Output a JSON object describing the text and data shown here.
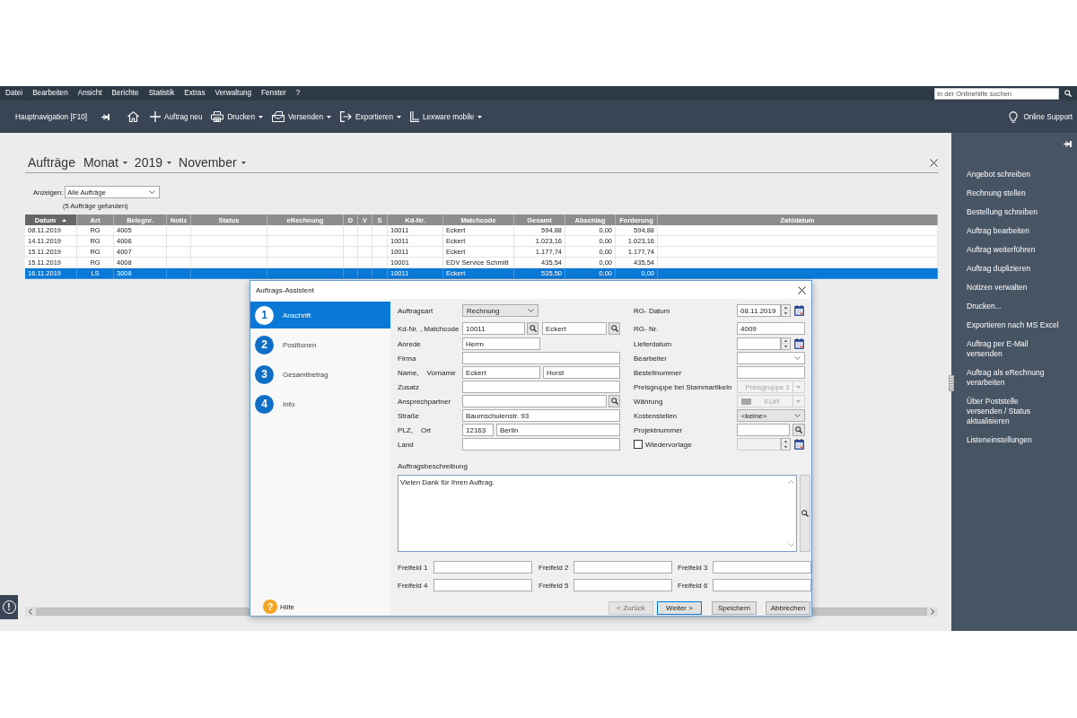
{
  "menu_bar": {
    "items": [
      "Datei",
      "Bearbeiten",
      "Ansicht",
      "Berichte",
      "Statistik",
      "Extras",
      "Verwaltung",
      "Fenster",
      "?"
    ],
    "search": {
      "placeholder": "In der Onlinehilfe suchen"
    }
  },
  "toolbar": {
    "navigation": "Hauptnavigation [F10]",
    "buttons": [
      {
        "label": "Auftrag neu",
        "dropdown": false
      },
      {
        "label": "Drucken",
        "dropdown": true
      },
      {
        "label": "Versenden",
        "dropdown": true
      },
      {
        "label": "Exportieren",
        "dropdown": true
      },
      {
        "label": "Lexware mobile",
        "dropdown": true
      }
    ],
    "support": "Online Support"
  },
  "orders": {
    "title": "Aufträge",
    "periods": [
      "Monat",
      "2019",
      "November"
    ],
    "filter": {
      "label": "Anzeigen:",
      "value": "Alle Aufträge"
    },
    "result_count": "(5 Aufträge gefunden)",
    "table": {
      "columns": [
        {
          "label": "Datum",
          "sorted": true
        },
        {
          "label": "Art",
          "sorted": false
        },
        {
          "label": "Belegnr.",
          "sorted": false
        },
        {
          "label": "Notiz",
          "sorted": false
        },
        {
          "label": "Status",
          "sorted": false
        },
        {
          "label": "eRechnung",
          "sorted": false
        },
        {
          "label": "D",
          "sorted": false
        },
        {
          "label": "V",
          "sorted": false
        },
        {
          "label": "S",
          "sorted": false
        },
        {
          "label": "Kd-Nr.",
          "sorted": false
        },
        {
          "label": "Matchcode",
          "sorted": false
        },
        {
          "label": "Gesamt",
          "sorted": false
        },
        {
          "label": "Abschlag",
          "sorted": false
        },
        {
          "label": "Forderung",
          "sorted": false
        },
        {
          "label": "Zahldatum",
          "sorted": false
        }
      ],
      "rows": [
        {
          "datum": "08.11.2019",
          "art": "RG",
          "belegnr": "4005",
          "kd_nr": "10011",
          "matchcode": "Eckert",
          "gesamt": "594,88",
          "abschlag": "0,00",
          "forderung": "594,88",
          "selected": false
        },
        {
          "datum": "14.11.2019",
          "art": "RG",
          "belegnr": "4006",
          "kd_nr": "10011",
          "matchcode": "Eckert",
          "gesamt": "1.023,16",
          "abschlag": "0,00",
          "forderung": "1.023,16",
          "selected": false
        },
        {
          "datum": "15.11.2019",
          "art": "RG",
          "belegnr": "4007",
          "kd_nr": "10011",
          "matchcode": "Eckert",
          "gesamt": "1.177,74",
          "abschlag": "0,00",
          "forderung": "1.177,74",
          "selected": false
        },
        {
          "datum": "15.11.2019",
          "art": "RG",
          "belegnr": "4008",
          "kd_nr": "10001",
          "matchcode": "EDV Service Schmitt",
          "gesamt": "435,54",
          "abschlag": "0,00",
          "forderung": "435,54",
          "selected": false
        },
        {
          "datum": "16.11.2019",
          "art": "LS",
          "belegnr": "3008",
          "kd_nr": "10011",
          "matchcode": "Eckert",
          "gesamt": "535,50",
          "abschlag": "0,00",
          "forderung": "0,00",
          "selected": true
        }
      ]
    },
    "notice": "!"
  },
  "sidebar": {
    "items": [
      "Angebot schreiben",
      "Rechnung stellen",
      "Bestellung schreiben",
      "Auftrag bearbeiten",
      "Auftrag weiterführen",
      "Auftrag duplizieren",
      "Notizen verwalten",
      "Drucken...",
      "Exportieren nach MS Excel",
      "Auftrag per E-Mail\nversenden",
      "Auftrag als eRechnung\nverarbeiten",
      "Über Poststelle\nversenden / Status\naktualisieren",
      "Listeneinstellungen"
    ]
  },
  "dialog": {
    "title": "Auftrags-Assistent",
    "steps": [
      {
        "number": "1",
        "label": "Anschrift",
        "selected": true
      },
      {
        "number": "2",
        "label": "Positionen",
        "selected": false
      },
      {
        "number": "3",
        "label": "Gesamtbetrag",
        "selected": false
      },
      {
        "number": "4",
        "label": "Info",
        "selected": false
      }
    ],
    "address_fields": [
      {
        "label": "Auftragsart",
        "inputs": [
          {
            "kind": "select",
            "value": "Rechnung"
          }
        ]
      },
      {
        "label": "Kd-Nr. , Matchcode",
        "inputs": [
          {
            "kind": "search",
            "value": "10011"
          },
          {
            "kind": "search",
            "value": "Eckert"
          }
        ]
      },
      {
        "label": "Anrede",
        "inputs": [
          {
            "kind": "text",
            "value": "Herrn"
          }
        ]
      },
      {
        "label": "Firma",
        "inputs": [
          {
            "kind": "text"
          }
        ]
      },
      {
        "label": "Name,",
        "label_2": "Vorname",
        "inputs": [
          {
            "kind": "text",
            "value": "Eckert"
          },
          {
            "kind": "text",
            "value": "Horst"
          }
        ]
      },
      {
        "label": "Zusatz",
        "inputs": [
          {
            "kind": "text"
          }
        ]
      },
      {
        "label": "Ansprechpartner",
        "inputs": [
          {
            "kind": "search"
          }
        ]
      },
      {
        "label": "Straße",
        "inputs": [
          {
            "kind": "text",
            "value": "Baumschulenstr. 93"
          }
        ]
      },
      {
        "label": "PLZ,",
        "label_2": "Ort",
        "inputs": [
          {
            "kind": "text",
            "value": "12163"
          },
          {
            "kind": "text",
            "value": "Berlin"
          }
        ]
      },
      {
        "label": "Land",
        "inputs": [
          {
            "kind": "text"
          }
        ]
      }
    ],
    "order_fields": [
      {
        "label": "RG- Datum",
        "kind": "date",
        "value": "08.11.2019",
        "disabled": false
      },
      {
        "label": "RG- Nr.",
        "kind": "text",
        "value": "4009",
        "disabled": false
      },
      {
        "label": "Lieferdatum",
        "kind": "date",
        "disabled": false
      },
      {
        "label": "Bearbeiter",
        "kind": "combo",
        "disabled": false
      },
      {
        "label": "Bestellnummer",
        "kind": "text",
        "disabled": false
      },
      {
        "label": "Preisgruppe bei Stammartikeln",
        "kind": "picker",
        "value": "Preisgruppe 1",
        "disabled": true
      },
      {
        "label": "Währung",
        "kind": "currency",
        "value": "EUR",
        "disabled": true
      },
      {
        "label": "Kostenstellen",
        "kind": "select",
        "value": "<keine>",
        "disabled": false
      },
      {
        "label": "Projektnummer",
        "kind": "search",
        "disabled": false
      },
      {
        "label": "Wiedervorlage",
        "kind": "date",
        "checkbox": {
          "checked": false
        },
        "disabled": true
      }
    ],
    "description": {
      "label": "Auftragsbeschreibung",
      "value": "Vielen Dank für Ihren Auftrag."
    },
    "free_fields": [
      "Freifeld 1",
      "Freifeld 2",
      "Freifeld 3",
      "Freifeld 4",
      "Freifeld 5",
      "Freifeld 6"
    ],
    "help": {
      "glyph": "?",
      "label": "Hilfe"
    },
    "buttons": [
      {
        "label": "< Zurück",
        "disabled": true,
        "default": false
      },
      {
        "label": "Weiter >",
        "disabled": false,
        "default": true
      },
      {
        "label": "Speichern",
        "disabled": false,
        "default": false
      },
      {
        "label": "Abbrechen",
        "disabled": false,
        "default": false
      }
    ]
  }
}
